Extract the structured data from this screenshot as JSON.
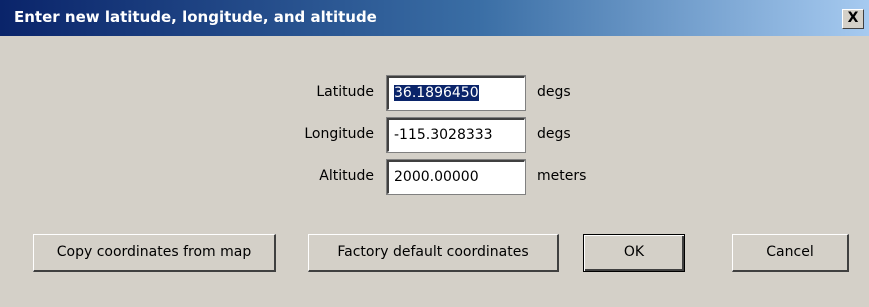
{
  "dialog": {
    "title": "Enter new latitude, longitude, and altitude",
    "close_glyph": "X"
  },
  "fields": {
    "latitude": {
      "label": "Latitude",
      "value": "36.1896450",
      "unit": "degs"
    },
    "longitude": {
      "label": "Longitude",
      "value": "-115.3028333",
      "unit": "degs"
    },
    "altitude": {
      "label": "Altitude",
      "value": "2000.00000",
      "unit": "meters"
    }
  },
  "buttons": {
    "copy": "Copy coordinates from map",
    "factory": "Factory default coordinates",
    "ok": "OK",
    "cancel": "Cancel"
  },
  "colors": {
    "dialog_bg": "#d4d0c8",
    "title_start": "#0a246a",
    "title_end": "#a6caf0",
    "selection": "#0a246a"
  }
}
